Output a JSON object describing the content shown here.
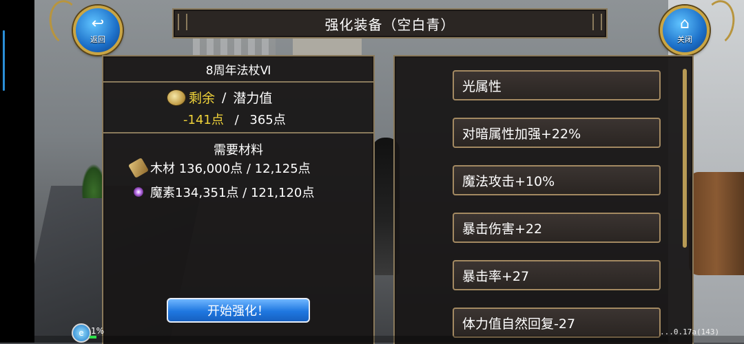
{
  "title": "强化装备（空白青）",
  "back_button": {
    "label": "返回",
    "icon": "back-arrow-icon"
  },
  "close_button": {
    "label": "关闭",
    "icon": "home-icon"
  },
  "item": {
    "name": "8周年法杖Ⅵ",
    "remain_label": "剩余",
    "slash": "/",
    "potential_label": "潜力值",
    "remain_value": "-141点",
    "potential_value": "365点"
  },
  "materials": {
    "title": "需要材料",
    "rows": [
      {
        "icon": "wood-icon",
        "text": "木材 136,000点 / 12,125点"
      },
      {
        "icon": "magic-essence-icon",
        "text": "魔素134,351点 / 121,120点"
      }
    ]
  },
  "start_button": {
    "label": "开始强化！"
  },
  "stats": [
    "光属性",
    "对暗属性加强+22%",
    "魔法攻击+10%",
    "暴击伤害+22",
    "暴击率+27",
    "体力值自然回复-27"
  ],
  "hud": {
    "percent": "1%",
    "version": "...0.17a(143)"
  },
  "colors": {
    "gold_border": "#8a7a5c",
    "remain_yellow": "#f0d33a",
    "button_blue": "#1f77e0"
  }
}
